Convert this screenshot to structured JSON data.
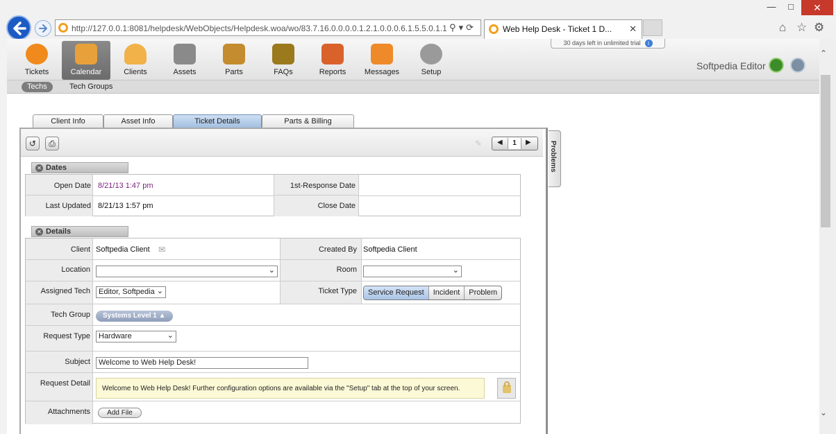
{
  "browser": {
    "url": "http://127.0.0.1:8081/helpdesk/WebObjects/Helpdesk.woa/wo/83.7.16.0.0.0.0.1.2.1.0.0.0.6.1.5.5.0.1.1.1.",
    "url_host": "127.0.0.1",
    "tab_title": "Web Help Desk - Ticket 1 D...",
    "trial_notice": "30 days left in unlimited trial"
  },
  "nav": {
    "items": [
      {
        "label": "Tickets",
        "color": "#f08a1d"
      },
      {
        "label": "Calendar",
        "color": "#e8a03a"
      },
      {
        "label": "Clients",
        "color": "#f1b24a"
      },
      {
        "label": "Assets",
        "color": "#8a8a8a"
      },
      {
        "label": "Parts",
        "color": "#c48b2f"
      },
      {
        "label": "FAQs",
        "color": "#9b7a1e"
      },
      {
        "label": "Reports",
        "color": "#d9622b"
      },
      {
        "label": "Messages",
        "color": "#ef8a2a"
      },
      {
        "label": "Setup",
        "color": "#9a9a9a"
      }
    ],
    "selected": "Calendar",
    "user": "Softpedia Editor"
  },
  "subnav": {
    "items": [
      "Techs",
      "Tech Groups"
    ],
    "selected": "Techs"
  },
  "form_tabs": [
    "Client Info",
    "Asset Info",
    "Ticket Details",
    "Parts & Billing"
  ],
  "form_tab_selected": "Ticket Details",
  "pager": {
    "page": "1"
  },
  "problems_tab": "Problems",
  "dates": {
    "header": "Dates",
    "open_date_label": "Open Date",
    "open_date": "8/21/13 1:47 pm",
    "first_response_label": "1st-Response Date",
    "first_response": "",
    "last_updated_label": "Last Updated",
    "last_updated": "8/21/13 1:57 pm",
    "close_date_label": "Close Date",
    "close_date": ""
  },
  "details": {
    "header": "Details",
    "client_label": "Client",
    "client": "Softpedia Client",
    "created_by_label": "Created By",
    "created_by": "Softpedia Client",
    "location_label": "Location",
    "location": "",
    "room_label": "Room",
    "room": "",
    "assigned_tech_label": "Assigned Tech",
    "assigned_tech": "Editor, Softpedia",
    "ticket_type_label": "Ticket Type",
    "ticket_types": [
      "Service Request",
      "Incident",
      "Problem"
    ],
    "ticket_type_selected": "Service Request",
    "tech_group_label": "Tech Group",
    "tech_group": "Systems  Level 1",
    "request_type_label": "Request Type",
    "request_type": "Hardware",
    "subject_label": "Subject",
    "subject": "Welcome to Web Help Desk!",
    "request_detail_label": "Request Detail",
    "request_detail": "Welcome to Web Help Desk! Further configuration options are available via the \"Setup\" tab at the top of your screen.",
    "attachments_label": "Attachments",
    "add_file": "Add File"
  }
}
